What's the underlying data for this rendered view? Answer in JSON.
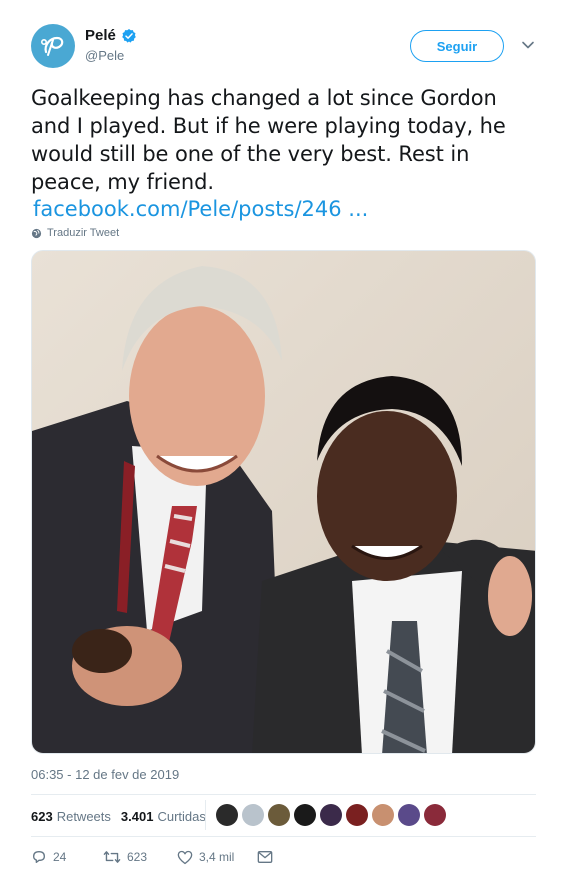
{
  "author": {
    "display_name": "Pelé",
    "handle": "@Pele",
    "verified": true
  },
  "follow_button_label": "Seguir",
  "tweet": {
    "text": "Goalkeeping has changed a lot since Gordon and I played. But if he were playing today, he would still be one of the very best. Rest in peace, my friend.",
    "link_text": "facebook.com/Pele/posts/246 ..."
  },
  "translate_label": "Traduzir Tweet",
  "timestamp": "06:35 - 12 de fev de 2019",
  "stats": {
    "retweets_count": "623",
    "retweets_label": "Retweets",
    "likes_count": "3.401",
    "likes_label": "Curtidas"
  },
  "liker_colors": [
    "#2a2a2a",
    "#b9c3cc",
    "#6b5b3a",
    "#1a1a1a",
    "#3b2a4a",
    "#7a2020",
    "#c89070",
    "#5a4a8a",
    "#8a2a3a"
  ],
  "actions": {
    "reply_count": "24",
    "retweet_count": "623",
    "like_count": "3,4 mil"
  },
  "icons": [
    "avatar-logo-icon",
    "verified-badge-icon",
    "chevron-down-icon",
    "globe-icon",
    "reply-icon",
    "retweet-icon",
    "heart-icon",
    "mail-icon"
  ],
  "colors": {
    "accent": "#1da1f2",
    "link": "#1b95e0",
    "muted": "#657786",
    "avatar_bg": "#4aa8d3"
  }
}
